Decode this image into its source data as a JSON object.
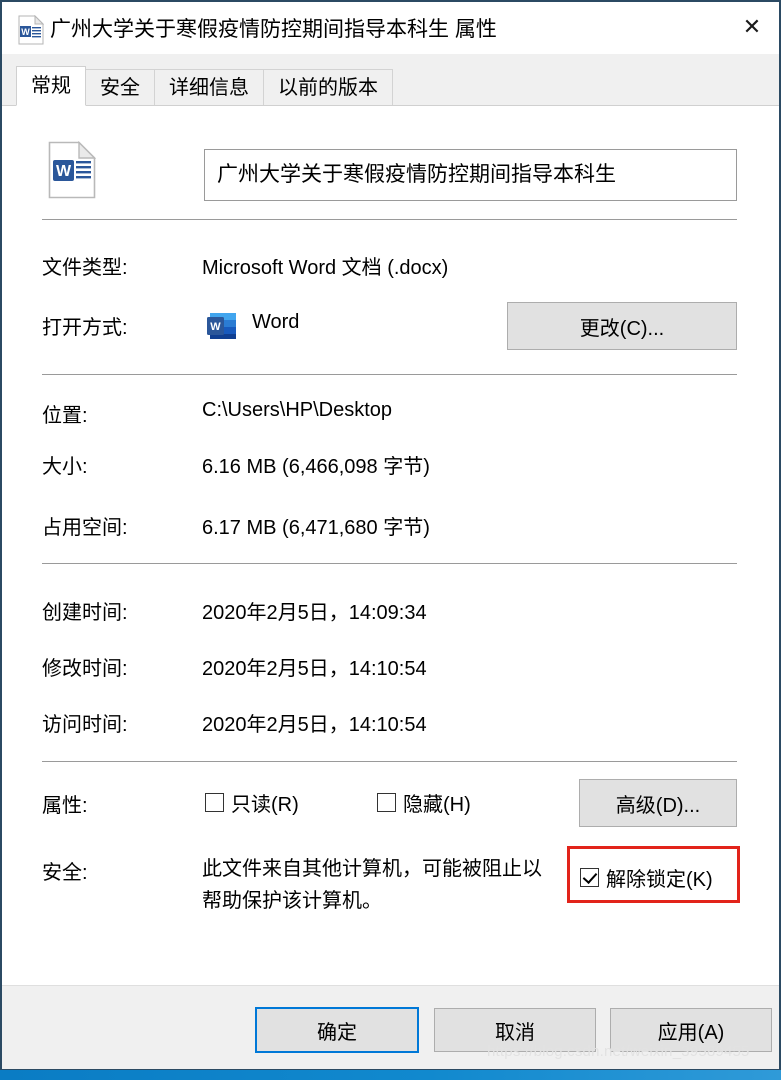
{
  "window": {
    "title": "广州大学关于寒假疫情防控期间指导本科生 属性",
    "icon": "word-document-icon",
    "close_label": "✕"
  },
  "tabs": [
    {
      "label": "常规",
      "active": true
    },
    {
      "label": "安全",
      "active": false
    },
    {
      "label": "详细信息",
      "active": false
    },
    {
      "label": "以前的版本",
      "active": false
    }
  ],
  "general": {
    "filename": "广州大学关于寒假疫情防控期间指导本科生",
    "doc_icon": "word-document-icon",
    "rows": [
      {
        "label": "文件类型:",
        "value": "Microsoft Word 文档 (.docx)"
      },
      {
        "label": "打开方式:",
        "value": "Word"
      },
      {
        "label": "位置:",
        "value": "C:\\Users\\HP\\Desktop"
      },
      {
        "label": "大小:",
        "value": "6.16 MB (6,466,098 字节)"
      },
      {
        "label": "占用空间:",
        "value": "6.17 MB (6,471,680 字节)"
      },
      {
        "label": "创建时间:",
        "value": "2020年2月5日，14:09:34"
      },
      {
        "label": "修改时间:",
        "value": "2020年2月5日，14:10:54"
      },
      {
        "label": "访问时间:",
        "value": "2020年2月5日，14:10:54"
      },
      {
        "label": "属性:",
        "value": ""
      },
      {
        "label": "安全:",
        "value": ""
      }
    ],
    "change_button": "更改(C)...",
    "advanced_button": "高级(D)...",
    "open_with_app": "Word",
    "attributes": {
      "readonly": {
        "label": "只读(R)",
        "checked": false
      },
      "hidden": {
        "label": "隐藏(H)",
        "checked": false
      }
    },
    "security": {
      "text_line1": "此文件来自其他计算机，可能被阻止以",
      "text_line2": "帮助保护该计算机。",
      "unblock": {
        "label": "解除锁定(K)",
        "checked": true
      }
    }
  },
  "footer": {
    "ok": "确定",
    "cancel": "取消",
    "apply": "应用(A)"
  },
  "watermark": "https://blog.csdn.net/weixin_39589455",
  "colors": {
    "accent": "#0078d7",
    "annotation": "#e2231a",
    "word_blue": "#2b579a",
    "frame": "#2b4a63"
  }
}
